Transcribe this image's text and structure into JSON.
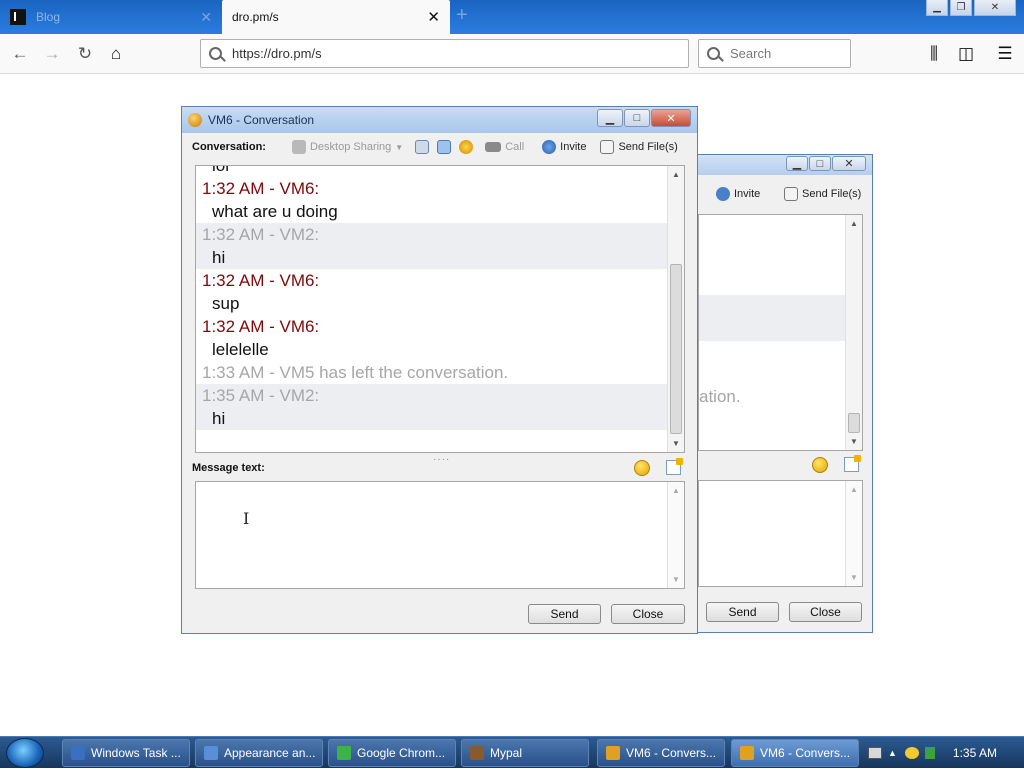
{
  "browser": {
    "tabs": [
      {
        "title": "Blog",
        "active": false
      },
      {
        "title": "dro.pm/s",
        "active": true
      }
    ],
    "url": "https://dro.pm/s",
    "search_placeholder": "Search"
  },
  "conversation_window": {
    "title": "VM6 - Conversation",
    "toolbar": {
      "label": "Conversation:",
      "desktop_sharing": "Desktop Sharing",
      "call": "Call",
      "invite": "Invite",
      "send_files": "Send File(s)"
    },
    "messages": [
      {
        "kind": "body",
        "text": "lol"
      },
      {
        "kind": "hdr-other",
        "text": "1:32 AM - VM6:"
      },
      {
        "kind": "body",
        "text": "what are u doing"
      },
      {
        "kind": "hdr-me",
        "text": "1:32 AM - VM2:",
        "shade": true
      },
      {
        "kind": "body",
        "text": "hi",
        "shade": true
      },
      {
        "kind": "hdr-other",
        "text": "1:32 AM - VM6:"
      },
      {
        "kind": "body",
        "text": "sup"
      },
      {
        "kind": "hdr-other",
        "text": "1:32 AM - VM6:"
      },
      {
        "kind": "body",
        "text": "lelelelle"
      },
      {
        "kind": "sys",
        "text": "1:33 AM - VM5 has left the conversation."
      },
      {
        "kind": "hdr-me",
        "text": "1:35 AM - VM2:",
        "shade": true
      },
      {
        "kind": "body",
        "text": "hi",
        "shade": true
      }
    ],
    "message_label": "Message text:",
    "message_value": "",
    "send": "Send",
    "close": "Close"
  },
  "back_window": {
    "invite": "Invite",
    "send_files": "Send File(s)",
    "partial_text": "ation.",
    "send": "Send",
    "close": "Close"
  },
  "taskbar": {
    "tasks": [
      {
        "label": "Windows Task ...",
        "color": "#3b6fc2"
      },
      {
        "label": "Appearance an...",
        "color": "#5a8fd8"
      },
      {
        "label": "Google Chrom...",
        "color": "#3bb34a"
      },
      {
        "label": "Mypal",
        "color": "#8b5a2b"
      },
      {
        "label": "VM6 - Convers...",
        "color": "#e0a020"
      },
      {
        "label": "VM6 - Convers...",
        "color": "#e0a020",
        "active": true
      }
    ],
    "clock": "1:35 AM"
  }
}
